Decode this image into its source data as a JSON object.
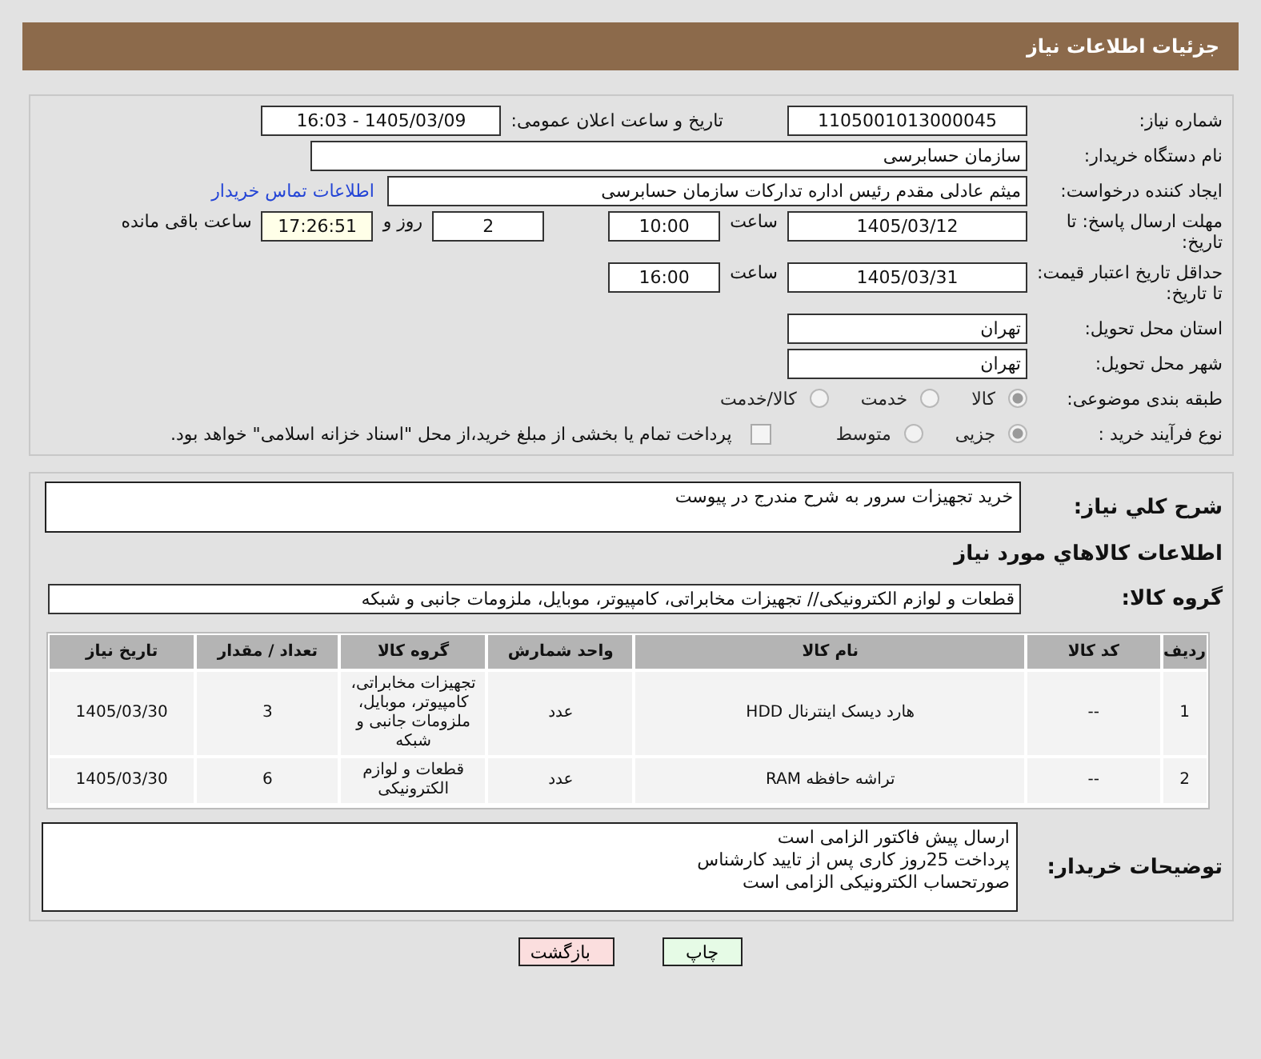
{
  "header": {
    "title": "جزئیات اطلاعات نیاز"
  },
  "form": {
    "need_number": {
      "label": "شماره نیاز:",
      "value": "1105001013000045"
    },
    "announce": {
      "label": "تاریخ و ساعت اعلان عمومی:",
      "value": "1405/03/09 - 16:03"
    },
    "buyer": {
      "label": "نام دستگاه خریدار:",
      "value": "سازمان حسابرسی"
    },
    "requester": {
      "label": "ایجاد کننده درخواست:",
      "value": "میثم عادلی مقدم رئیس اداره تدارکات سازمان حسابرسی",
      "link": "اطلاعات تماس خریدار"
    },
    "deadline": {
      "label": "مهلت ارسال پاسخ: تا تاریخ:",
      "date": "1405/03/12",
      "time_label": "ساعت",
      "time": "10:00",
      "days": "2",
      "days_label": "روز و",
      "remaining": "17:26:51",
      "remaining_label": "ساعت باقی مانده"
    },
    "validity": {
      "label": "حداقل تاریخ اعتبار قیمت: تا تاریخ:",
      "date": "1405/03/31",
      "time_label": "ساعت",
      "time": "16:00"
    },
    "province": {
      "label": "استان محل تحویل:",
      "value": "تهران"
    },
    "city": {
      "label": "شهر محل تحویل:",
      "value": "تهران"
    },
    "category": {
      "label": "طبقه بندی موضوعی:",
      "options": [
        {
          "label": "کالا",
          "selected": true
        },
        {
          "label": "خدمت",
          "selected": false
        },
        {
          "label": "کالا/خدمت",
          "selected": false
        }
      ]
    },
    "process": {
      "label": "نوع فرآیند خرید :",
      "options": [
        {
          "label": "جزیی",
          "selected": true
        },
        {
          "label": "متوسط",
          "selected": false
        }
      ],
      "checkbox": {
        "label": "پرداخت تمام یا بخشی از مبلغ خرید،از محل \"اسناد خزانه اسلامی\" خواهد بود.",
        "checked": false
      }
    }
  },
  "details": {
    "description": {
      "label": "شرح کلي نياز:",
      "value": "خرید تجهیزات سرور به شرح مندرج در پیوست"
    },
    "section_title": "اطلاعات کالاهاي مورد نياز",
    "group": {
      "label": "گروه کالا:",
      "value": "قطعات و لوازم الکترونیکی// تجهیزات مخابراتی، کامپیوتر، موبایل، ملزومات جانبی و شبکه"
    },
    "table": {
      "columns": [
        "ردیف",
        "کد کالا",
        "نام کالا",
        "واحد شمارش",
        "گروه کالا",
        "تعداد / مقدار",
        "تاریخ نیاز"
      ],
      "rows": [
        [
          "1",
          "--",
          "هارد دیسک اینترنال HDD",
          "عدد",
          "تجهیزات مخابراتی، کامپیوتر، موبایل، ملزومات جانبی و شبکه",
          "3",
          "1405/03/30"
        ],
        [
          "2",
          "--",
          "تراشه حافظه RAM",
          "عدد",
          "قطعات و لوازم الکترونیکی",
          "6",
          "1405/03/30"
        ]
      ]
    },
    "notes": {
      "label": "توضیحات خریدار:",
      "lines": [
        "ارسال پیش فاکتور الزامی است",
        "پرداخت 25روز کاری پس از تایید کارشناس",
        "صورتحساب الکترونیکی الزامی است"
      ]
    }
  },
  "buttons": [
    {
      "label": "چاپ",
      "kind": "print"
    },
    {
      "label": "بازگشت",
      "kind": "back"
    }
  ]
}
